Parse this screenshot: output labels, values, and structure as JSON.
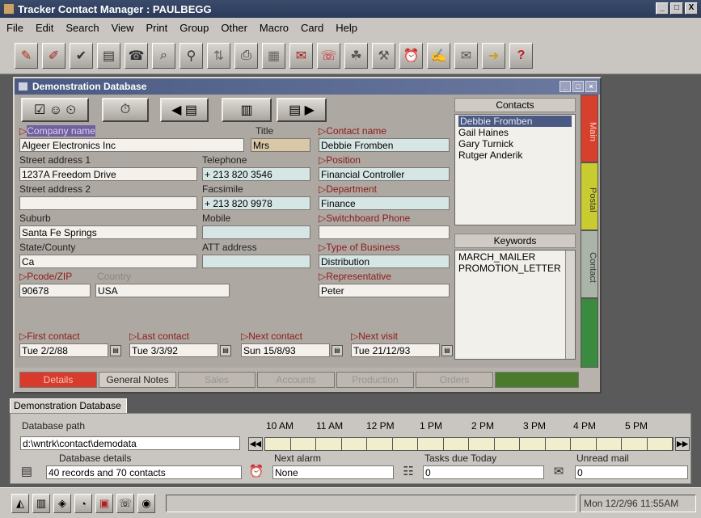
{
  "app": {
    "title": "Tracker Contact Manager : PAULBEGG",
    "controls": [
      "_",
      "□",
      "X"
    ]
  },
  "menu": [
    "File",
    "Edit",
    "Search",
    "View",
    "Print",
    "Group",
    "Other",
    "Macro",
    "Card",
    "Help"
  ],
  "toolbar_icons": [
    "open-icon",
    "edit-icon",
    "check-icon",
    "card-icon",
    "phone-icon",
    "search-icon",
    "find-icon",
    "sort-icon",
    "print-icon",
    "report-icon",
    "address-icon",
    "dial-icon",
    "group-icon",
    "tools-icon",
    "alarm-icon",
    "notes-icon",
    "mail-icon",
    "export-icon",
    "help-icon"
  ],
  "child": {
    "title": "Demonstration Database",
    "fields": {
      "company_label": "Company name",
      "company": "Algeer Electronics Inc",
      "title_label": "Title",
      "title": "Mrs",
      "contact_label": "Contact name",
      "contact": "Debbie Fromben",
      "street1_label": "Street address 1",
      "street1": "1237A Freedom Drive",
      "telephone_label": "Telephone",
      "telephone": "+ 213 820 3546",
      "position_label": "Position",
      "position": "Financial Controller",
      "street2_label": "Street address 2",
      "street2": "",
      "fax_label": "Facsimile",
      "fax": "+ 213 820 9978",
      "department_label": "Department",
      "department": "Finance",
      "suburb_label": "Suburb",
      "suburb": "Santa Fe Springs",
      "mobile_label": "Mobile",
      "mobile": "",
      "switchboard_label": "Switchboard Phone",
      "switchboard": "",
      "state_label": "State/County",
      "state": "Ca",
      "att_label": "ATT address",
      "att": "",
      "business_label": "Type of Business",
      "business": "Distribution",
      "zip_label": "Pcode/ZIP",
      "zip": "90678",
      "country_label": "Country",
      "country": "USA",
      "rep_label": "Representative",
      "rep": "Peter",
      "first_contact_label": "First contact",
      "first_contact": "Tue 2/2/88",
      "last_contact_label": "Last contact",
      "last_contact": "Tue 3/3/92",
      "next_contact_label": "Next contact",
      "next_contact": "Sun 15/8/93",
      "next_visit_label": "Next visit",
      "next_visit": "Tue 21/12/93"
    },
    "contacts": {
      "title": "Contacts",
      "items": [
        "Debbie Fromben",
        "Gail Haines",
        "Gary Turnick",
        "Rutger Anderik"
      ]
    },
    "keywords": {
      "title": "Keywords",
      "items": [
        "MARCH_MAILER",
        "PROMOTION_LETTER"
      ]
    },
    "side_tabs": [
      "Main",
      "Postal",
      "Contact",
      ""
    ],
    "bottom_tabs": [
      "Details",
      "General Notes",
      "Sales",
      "Accounts",
      "Production",
      "Orders",
      ""
    ]
  },
  "status": {
    "tab": "Demonstration Database",
    "db_path_label": "Database path",
    "db_path": "d:\\wntrk\\contact\\demodata",
    "db_details_label": "Database details",
    "db_details": "40 records and 70 contacts",
    "next_alarm_label": "Next alarm",
    "next_alarm": "None",
    "tasks_label": "Tasks due Today",
    "tasks": "0",
    "unread_label": "Unread mail",
    "unread": "0",
    "times": [
      "10 AM",
      "11 AM",
      "12 PM",
      "1 PM",
      "2 PM",
      "3 PM",
      "4 PM",
      "5 PM"
    ]
  },
  "taskbar": {
    "clock": "Mon 12/2/96  11:55AM"
  }
}
